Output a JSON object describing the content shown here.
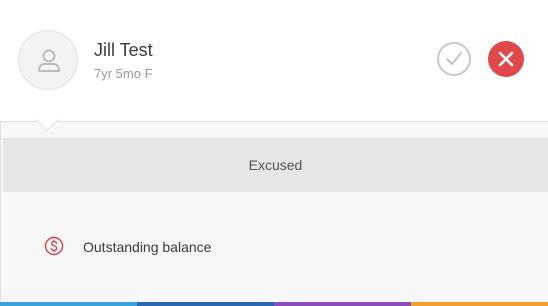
{
  "student": {
    "name": "Jill Test",
    "details": "7yr 5mo F"
  },
  "actions": {
    "check_icon": "check-circle-icon",
    "close_icon": "close-icon",
    "close_color": "#e0484a"
  },
  "status": {
    "label": "Excused"
  },
  "balance": {
    "icon": "dollar-circle-icon",
    "label": "Outstanding balance",
    "icon_color": "#d9414a"
  },
  "colors": {
    "stripe": [
      "#38a3d8",
      "#2a68b0",
      "#8a4fb8",
      "#f0a030"
    ]
  }
}
